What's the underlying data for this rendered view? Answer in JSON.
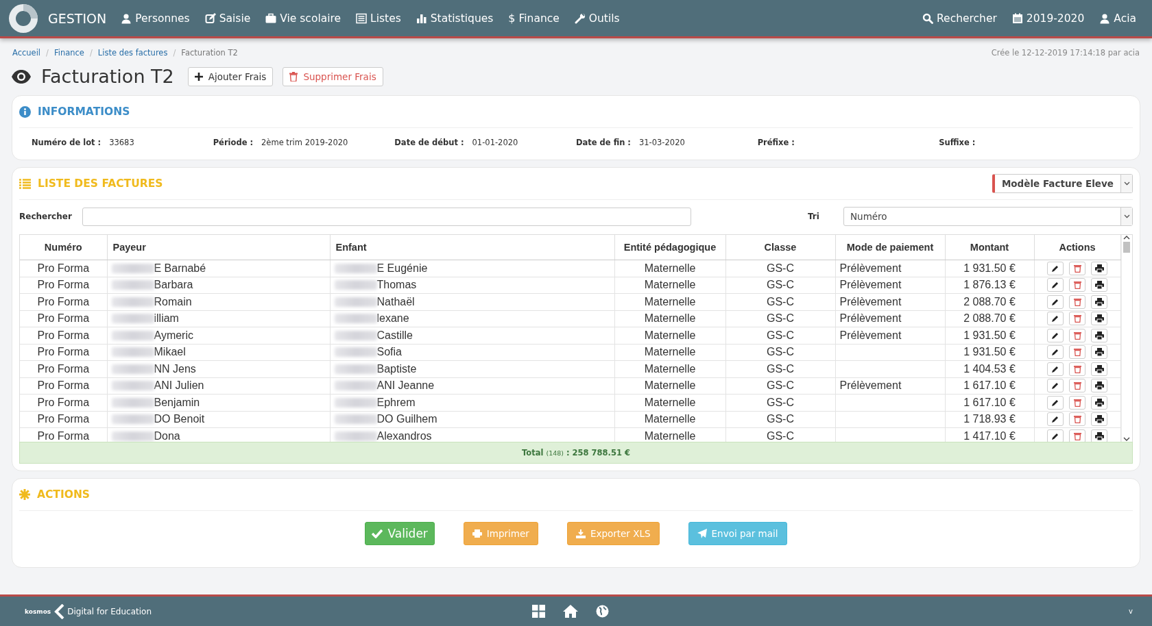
{
  "topbar": {
    "brand": "GESTION",
    "menu": [
      {
        "label": "Personnes"
      },
      {
        "label": "Saisie"
      },
      {
        "label": "Vie scolaire"
      },
      {
        "label": "Listes"
      },
      {
        "label": "Statistiques"
      },
      {
        "glyph": "$",
        "label": "Finance"
      },
      {
        "label": "Outils"
      }
    ],
    "right": [
      {
        "label": "Rechercher"
      },
      {
        "label": "2019-2020"
      },
      {
        "label": "Acia"
      }
    ]
  },
  "breadcrumb": [
    {
      "label": "Accueil",
      "current": false
    },
    {
      "sep": "/",
      "label": "Finance",
      "current": false
    },
    {
      "sep": "/",
      "label": "Liste des factures",
      "current": false
    },
    {
      "sep": "/",
      "label": "Facturation T2",
      "current": true
    }
  ],
  "created": "Crée le 12-12-2019 17:14:18 par acia",
  "title": "Facturation T2",
  "header_buttons": [
    {
      "label": "Ajouter Frais",
      "kind": "add"
    },
    {
      "label": "Supprimer Frais",
      "kind": "delete"
    }
  ],
  "info": {
    "title": "INFORMATIONS",
    "fields": [
      {
        "label": "Numéro de lot :",
        "value": "33683"
      },
      {
        "label": "Période :",
        "value": "2ème trim 2019-2020"
      },
      {
        "label": "Date de début :",
        "value": "01-01-2020"
      },
      {
        "label": "Date de fin :",
        "value": "31-03-2020"
      },
      {
        "label": "Préfixe :"
      },
      {
        "label": "Suffixe :"
      }
    ]
  },
  "invoices": {
    "title": "LISTE DES FACTURES",
    "model_select": {
      "value": "Modèle Facture Eleve"
    },
    "search": {
      "label": "Rechercher"
    },
    "sort": {
      "label": "Tri",
      "value": "Numéro"
    },
    "columns": [
      "Numéro",
      "Payeur",
      "Enfant",
      "Entité pédagogique",
      "Classe",
      "Mode de paiement",
      "Montant",
      "Actions"
    ],
    "rows": [
      {
        "numero": "Pro Forma",
        "payeur": "E Barnabé",
        "enfant": "E Eugénie",
        "entite": "Maternelle",
        "classe": "GS-C",
        "mode": "Prélèvement",
        "montant": "1 931.50 €"
      },
      {
        "numero": "Pro Forma",
        "payeur": "Barbara",
        "enfant": "Thomas",
        "entite": "Maternelle",
        "classe": "GS-C",
        "mode": "Prélèvement",
        "montant": "1 876.13 €"
      },
      {
        "numero": "Pro Forma",
        "payeur": "Romain",
        "enfant": "Nathaël",
        "entite": "Maternelle",
        "classe": "GS-C",
        "mode": "Prélèvement",
        "montant": "2 088.70 €"
      },
      {
        "numero": "Pro Forma",
        "payeur": "illiam",
        "enfant": "lexane",
        "entite": "Maternelle",
        "classe": "GS-C",
        "mode": "Prélèvement",
        "montant": "2 088.70 €"
      },
      {
        "numero": "Pro Forma",
        "payeur": "Aymeric",
        "enfant": "Castille",
        "entite": "Maternelle",
        "classe": "GS-C",
        "mode": "Prélèvement",
        "montant": "1 931.50 €"
      },
      {
        "numero": "Pro Forma",
        "payeur": "Mikael",
        "enfant": "Sofia",
        "entite": "Maternelle",
        "classe": "GS-C",
        "montant": "1 931.50 €"
      },
      {
        "numero": "Pro Forma",
        "payeur": "NN Jens",
        "enfant": "Baptiste",
        "entite": "Maternelle",
        "classe": "GS-C",
        "montant": "1 404.53 €"
      },
      {
        "numero": "Pro Forma",
        "payeur": "ANI Julien",
        "enfant": "ANI Jeanne",
        "entite": "Maternelle",
        "classe": "GS-C",
        "mode": "Prélèvement",
        "montant": "1 617.10 €"
      },
      {
        "numero": "Pro Forma",
        "payeur": "Benjamin",
        "enfant": "Ephrem",
        "entite": "Maternelle",
        "classe": "GS-C",
        "montant": "1 617.10 €"
      },
      {
        "numero": "Pro Forma",
        "payeur": "DO Benoit",
        "enfant": "DO Guilhem",
        "entite": "Maternelle",
        "classe": "GS-C",
        "montant": "1 718.93 €"
      },
      {
        "numero": "Pro Forma",
        "payeur": "Dona",
        "enfant": "Alexandros",
        "entite": "Maternelle",
        "classe": "GS-C",
        "montant": "1 417.10 €"
      }
    ],
    "total": {
      "label": "Total",
      "count": "(148)",
      "amount": ": 258 788.51 €"
    }
  },
  "actions": {
    "title": "ACTIONS",
    "buttons": [
      {
        "label": "Valider",
        "kind": "success"
      },
      {
        "label": "Imprimer",
        "kind": "print"
      },
      {
        "label": "Exporter XLS",
        "kind": "export"
      },
      {
        "label": "Envoi par mail",
        "kind": "mail"
      }
    ]
  },
  "footer": {
    "brand": "kosmos",
    "tagline": "Digital for Education",
    "version": "v"
  }
}
